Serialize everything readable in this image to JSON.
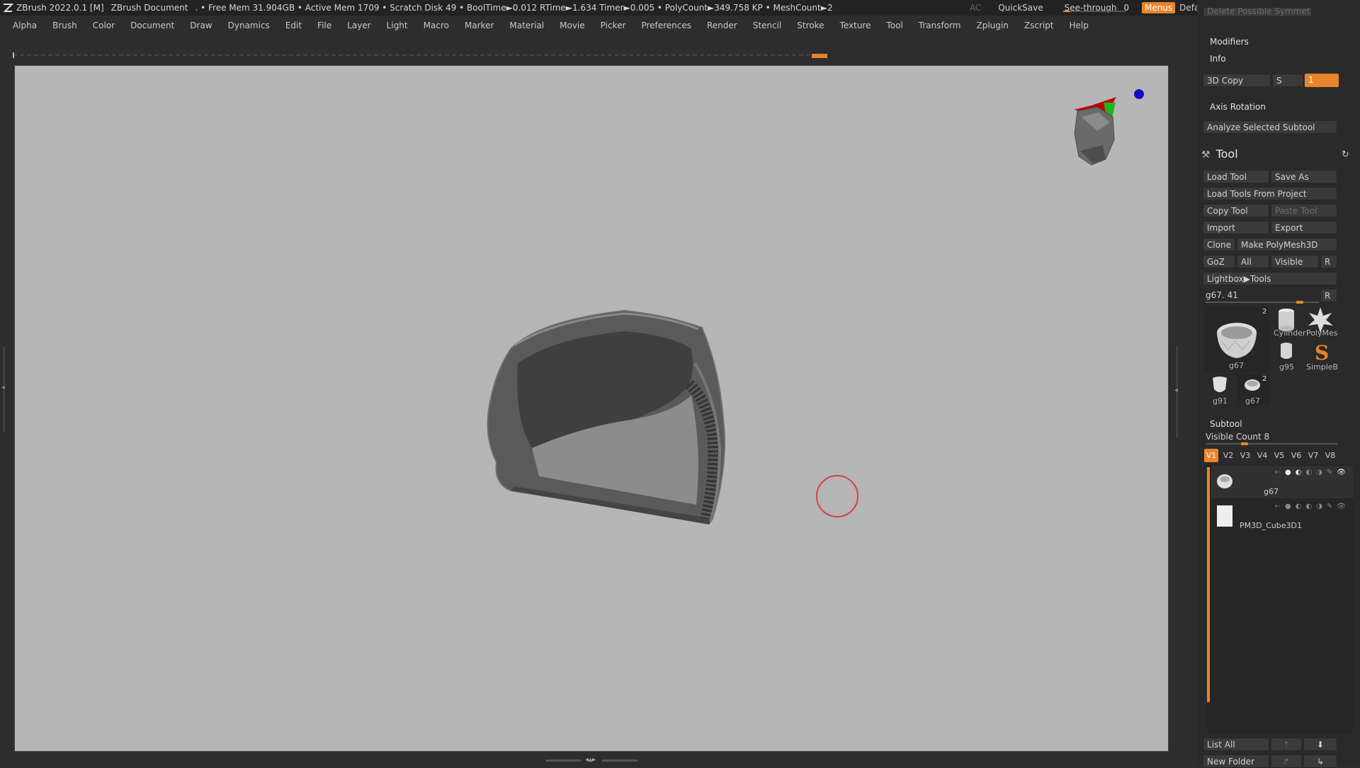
{
  "titlebar": {
    "app": "ZBrush 2022.0.1 [M]",
    "document": "ZBrush Document",
    "stats": ". • Free Mem 31.904GB • Active Mem 1709 • Scratch Disk 49 •  BoolTime►0.012 RTime►1.634 Timer►0.005 • PolyCount►349.758 KP  • MeshCount►2",
    "ac": "AC",
    "quicksave": "QuickSave",
    "see_through_label": "See-through",
    "see_through_value": "0",
    "menus": "Menus",
    "default_zscript": "DefaultZScript"
  },
  "menubar": [
    "Alpha",
    "Brush",
    "Color",
    "Document",
    "Draw",
    "Dynamics",
    "Edit",
    "File",
    "Layer",
    "Light",
    "Macro",
    "Marker",
    "Material",
    "Movie",
    "Picker",
    "Preferences",
    "Render",
    "Stencil",
    "Stroke",
    "Texture",
    "Tool",
    "Transform",
    "Zplugin",
    "Zscript",
    "Help"
  ],
  "panel": {
    "cut_top_button": "Delete Possible Symmetry",
    "modifiers": "Modifiers",
    "info": "Info",
    "copy3d": "3D Copy",
    "copy3d_s": "S",
    "copy3d_field": "1",
    "axis_rotation": "Axis Rotation",
    "analyze": "Analyze Selected Subtool",
    "tool_header": "Tool",
    "load_tool": "Load Tool",
    "save_as": "Save As",
    "load_tools_project": "Load Tools From Project",
    "copy_tool": "Copy Tool",
    "paste_tool": "Paste Tool",
    "import": "Import",
    "export": "Export",
    "clone": "Clone",
    "make_polymesh": "Make PolyMesh3D",
    "goz": "GoZ",
    "all": "All",
    "visible": "Visible",
    "r": "R",
    "lightbox_tools": "Lightbox▶Tools",
    "tool_slider_label": "g67. 41",
    "tool_slider_r": "R",
    "tool_thumbs": [
      {
        "label": "g67",
        "badge": "2"
      },
      {
        "label": "Cylinder"
      },
      {
        "label": "PolyMes"
      },
      {
        "label": "g95"
      },
      {
        "label": "SimpleB"
      },
      {
        "label": "g91"
      },
      {
        "label": "g67",
        "badge": "2"
      }
    ],
    "subtool_header": "Subtool",
    "visible_count": "Visible Count 8",
    "vtabs": [
      "V1",
      "V2",
      "V3",
      "V4",
      "V5",
      "V6",
      "V7",
      "V8"
    ],
    "subtools": [
      {
        "name": "g67"
      },
      {
        "name": "PM3D_Cube3D1"
      }
    ],
    "list_all": "List All",
    "new_folder": "New Folder"
  }
}
